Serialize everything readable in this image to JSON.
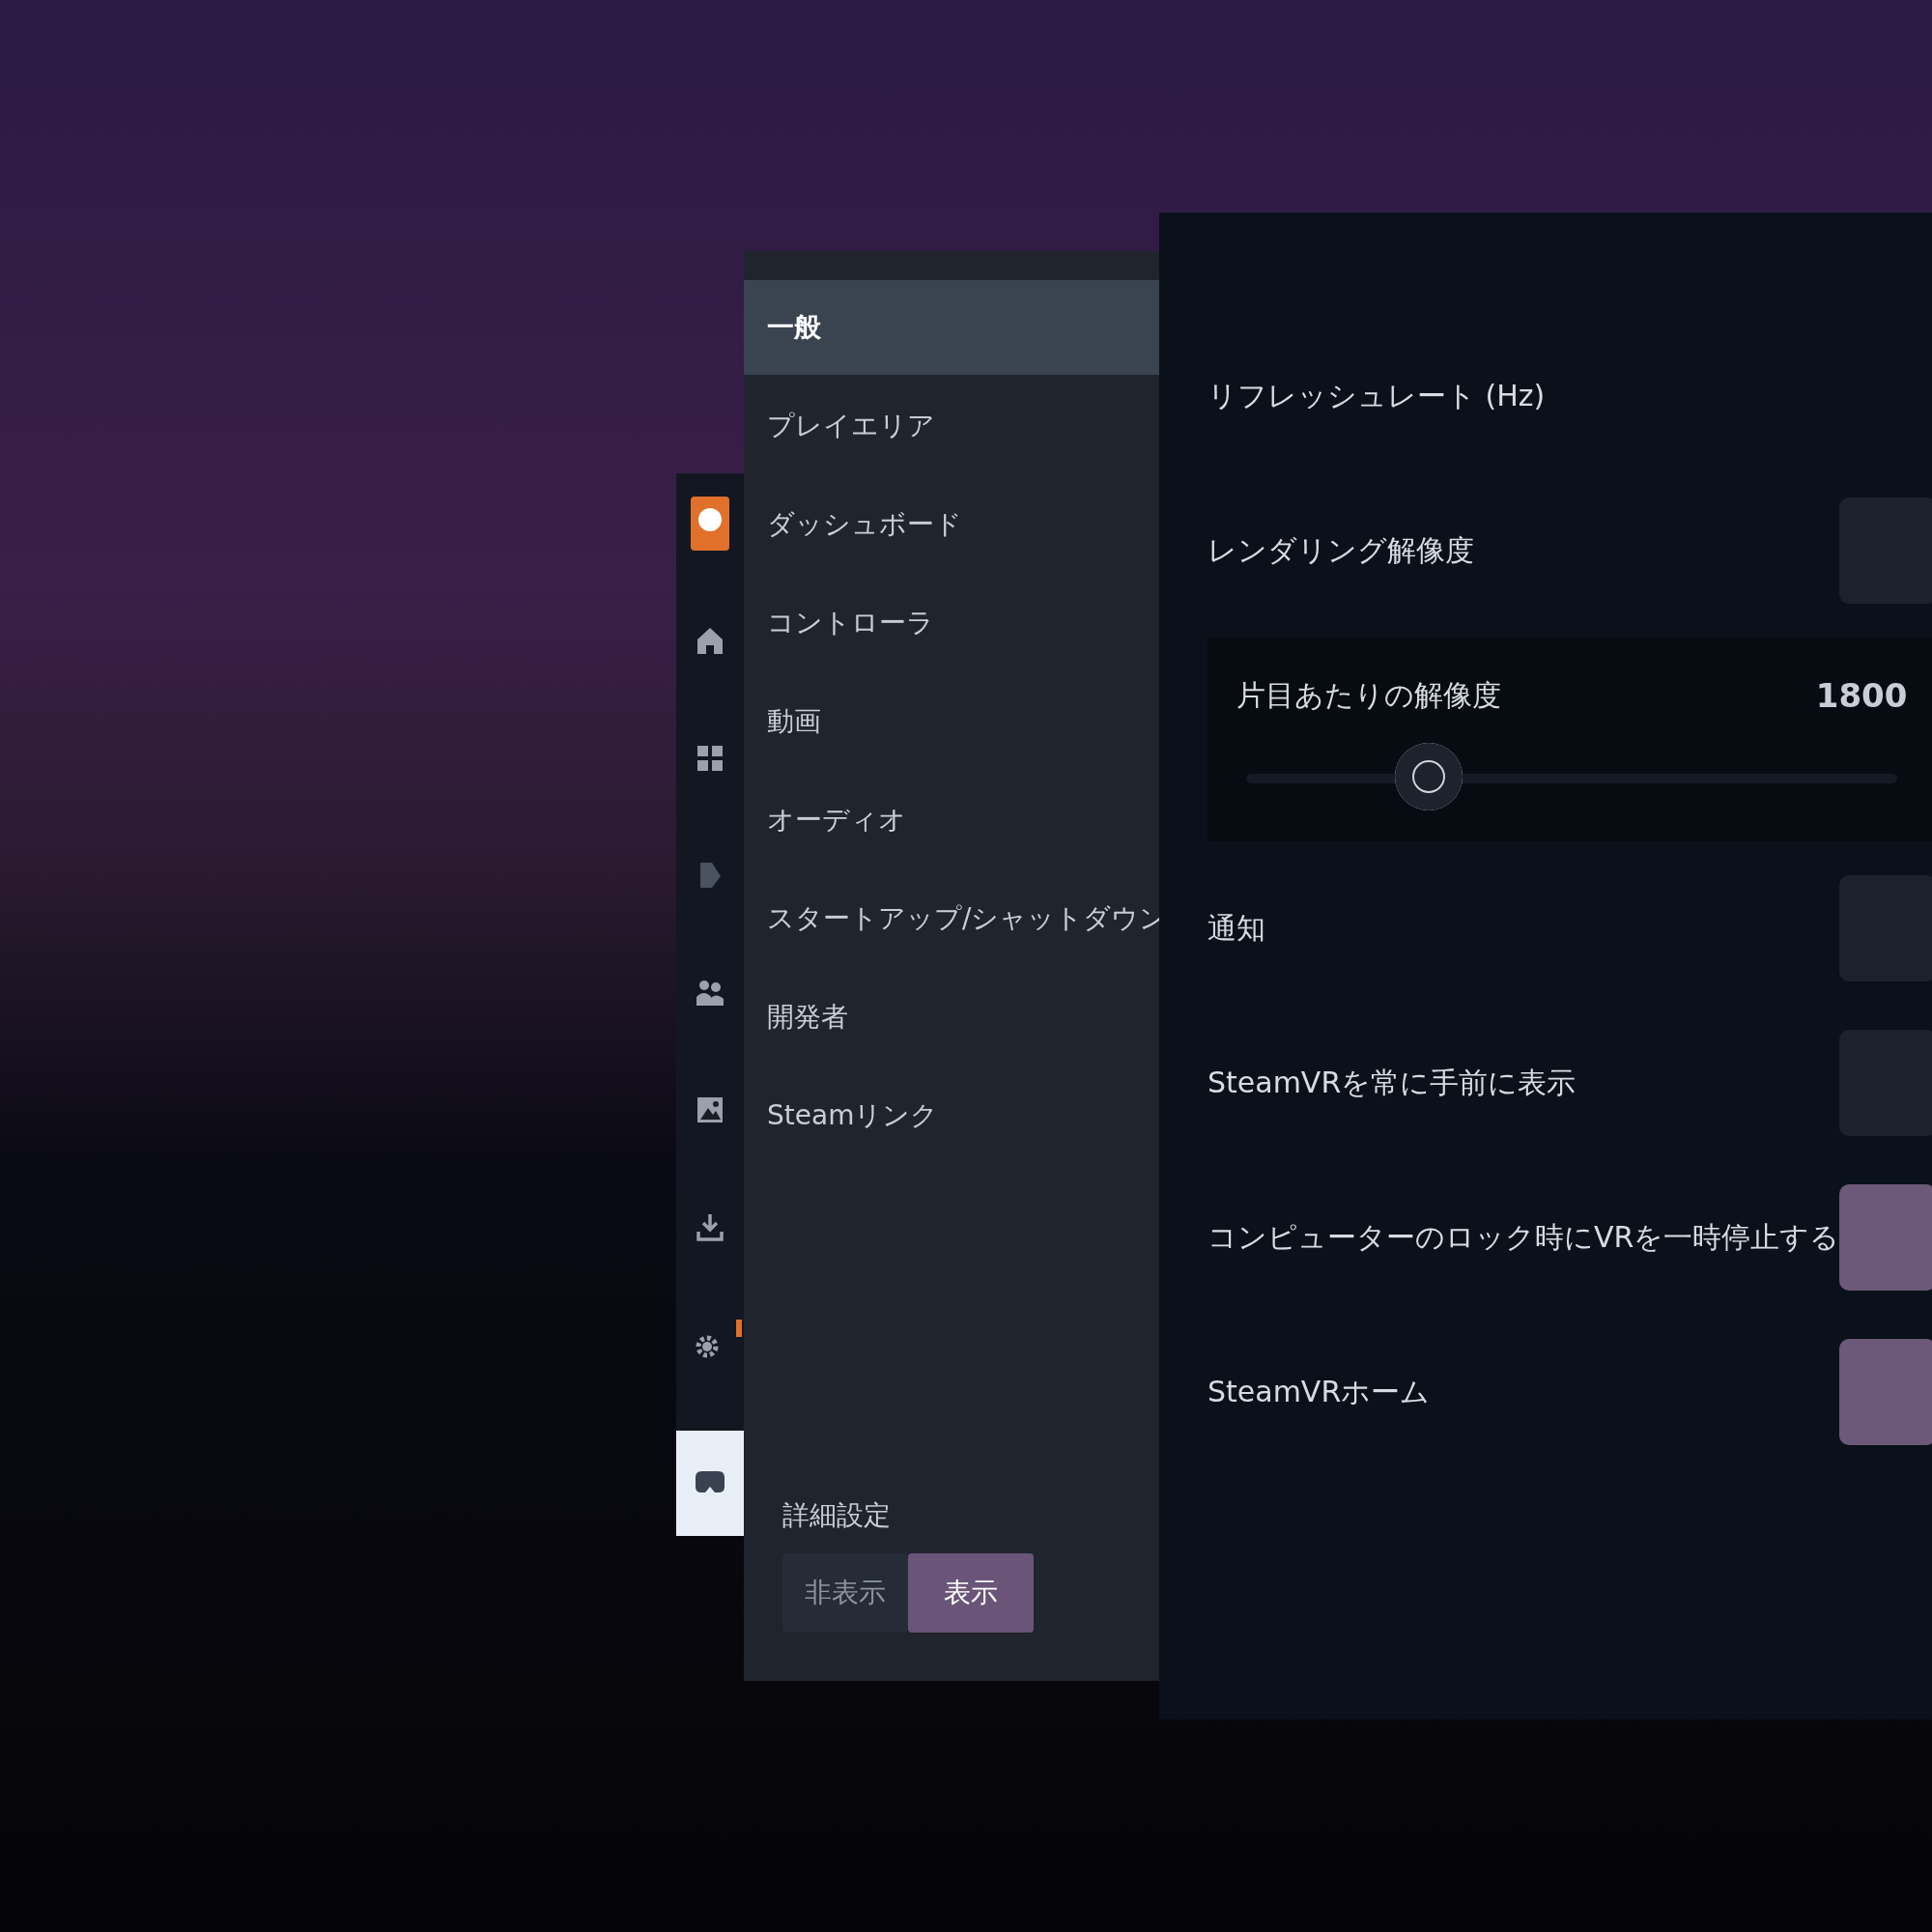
{
  "dock": {
    "items": [
      {
        "selected": false,
        "alert": false
      },
      {
        "selected": false,
        "alert": false
      },
      {
        "selected": false,
        "alert": false
      },
      {
        "selected": false,
        "alert": false
      },
      {
        "selected": false,
        "alert": false
      },
      {
        "selected": false,
        "alert": false
      },
      {
        "selected": false,
        "alert": false
      },
      {
        "selected": false,
        "alert": true
      },
      {
        "selected": true,
        "alert": false
      }
    ]
  },
  "menu": {
    "items": [
      {
        "label": "一般",
        "selected": true
      },
      {
        "label": "プレイエリア",
        "selected": false
      },
      {
        "label": "ダッシュボード",
        "selected": false
      },
      {
        "label": "コントローラ",
        "selected": false
      },
      {
        "label": "動画",
        "selected": false
      },
      {
        "label": "オーディオ",
        "selected": false
      },
      {
        "label": "スタートアップ/シャットダウン",
        "selected": false
      },
      {
        "label": "開発者",
        "selected": false
      },
      {
        "label": "Steamリンク",
        "selected": false
      }
    ],
    "advanced": {
      "label": "詳細設定",
      "options": [
        {
          "label": "非表示",
          "selected": false
        },
        {
          "label": "表示",
          "selected": true
        }
      ]
    }
  },
  "settings": [
    {
      "kind": "heading",
      "label": "リフレッシュレート (Hz)"
    },
    {
      "kind": "toggle",
      "label": "レンダリング解像度",
      "on": false
    },
    {
      "kind": "slider",
      "label": "片目あたりの解像度",
      "reading": "1800",
      "level": 0.28
    },
    {
      "kind": "toggle",
      "label": "通知",
      "on": false
    },
    {
      "kind": "toggle",
      "label": "SteamVRを常に手前に表示",
      "on": false
    },
    {
      "kind": "toggle",
      "label": "コンピューターのロック時にVRを一時停止する",
      "on": true
    },
    {
      "kind": "toggle",
      "label": "SteamVRホーム",
      "on": true
    }
  ]
}
